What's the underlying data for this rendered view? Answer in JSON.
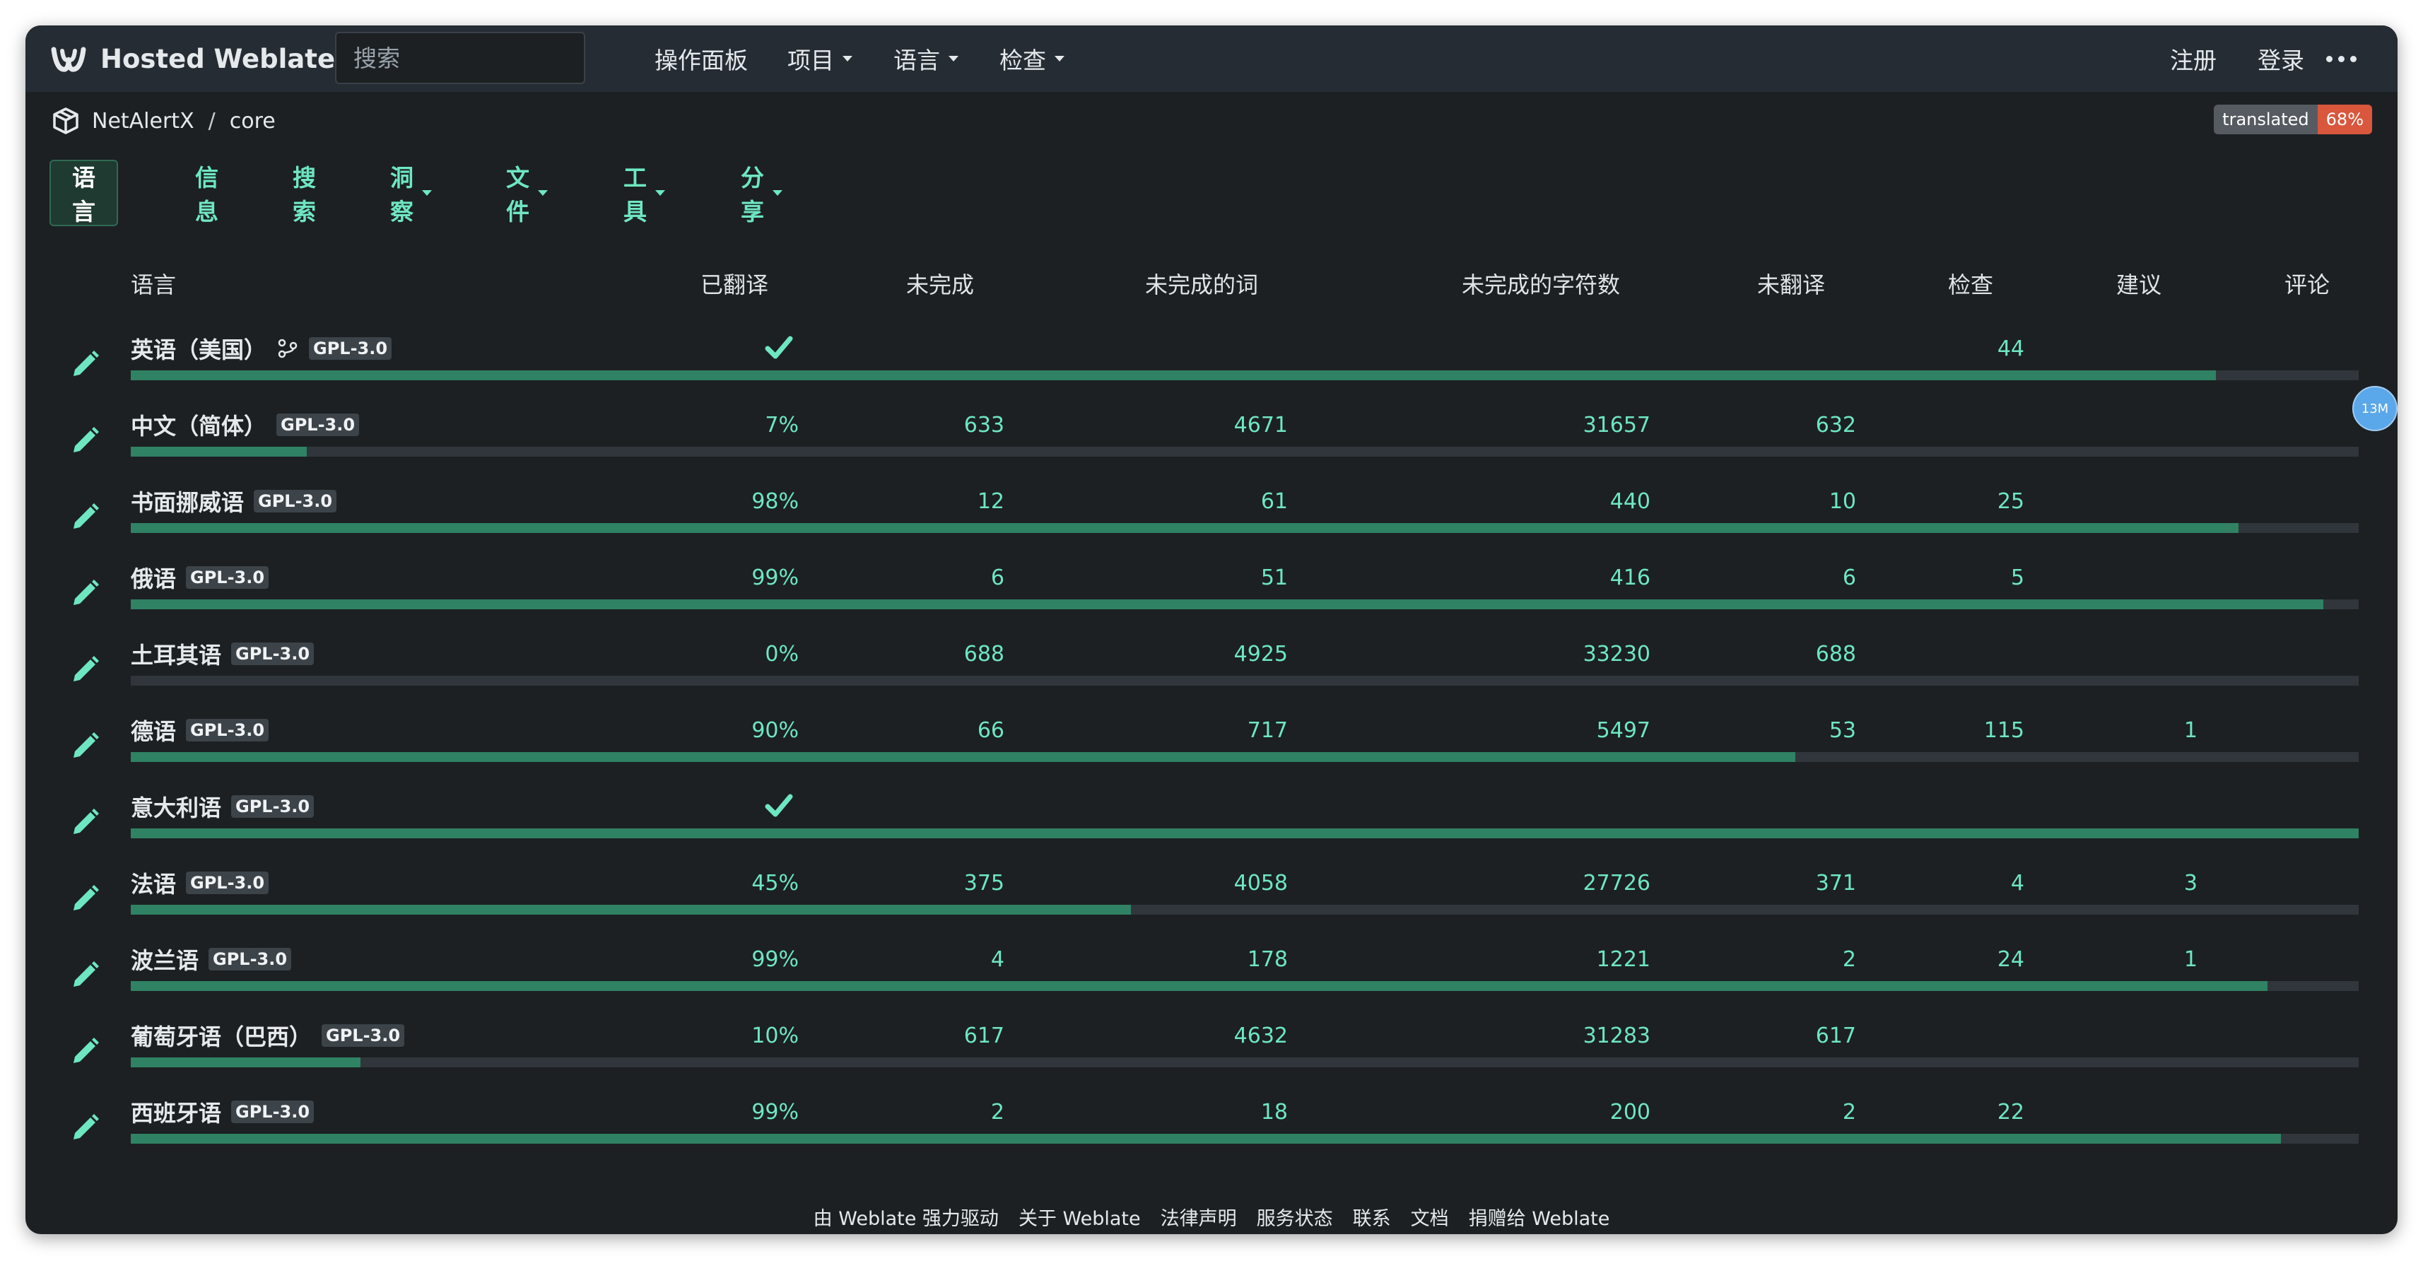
{
  "navbar": {
    "brand": "Hosted Weblate",
    "search_placeholder": "搜索",
    "items": [
      "操作面板",
      "项目",
      "语言",
      "检查"
    ],
    "right": [
      "注册",
      "登录"
    ]
  },
  "breadcrumb": {
    "project": "NetAlertX",
    "component": "core"
  },
  "badge": {
    "label": "translated",
    "value": "68%"
  },
  "tabs": [
    "语言",
    "信息",
    "搜索",
    "洞察",
    "文件",
    "工具",
    "分享"
  ],
  "table": {
    "headers": [
      "语言",
      "已翻译",
      "未完成",
      "未完成的词",
      "未完成的字符数",
      "未翻译",
      "检查",
      "建议",
      "评论"
    ],
    "rows": [
      {
        "lang": "英语（美国）",
        "license": "GPL-3.0",
        "source": true,
        "translated": "",
        "complete": true,
        "pending": "",
        "words": "",
        "chars": "",
        "untranslated": "",
        "checks": "44",
        "suggestions": "",
        "progress": 0.936
      },
      {
        "lang": "中文（简体）",
        "license": "GPL-3.0",
        "translated": "7%",
        "pending": "633",
        "words": "4671",
        "chars": "31657",
        "untranslated": "632",
        "checks": "",
        "suggestions": "",
        "progress": 0.079
      },
      {
        "lang": "书面挪威语",
        "license": "GPL-3.0",
        "translated": "98%",
        "pending": "12",
        "words": "61",
        "chars": "440",
        "untranslated": "10",
        "checks": "25",
        "suggestions": "",
        "progress": 0.946
      },
      {
        "lang": "俄语",
        "license": "GPL-3.0",
        "translated": "99%",
        "pending": "6",
        "words": "51",
        "chars": "416",
        "untranslated": "6",
        "checks": "5",
        "suggestions": "",
        "progress": 0.984
      },
      {
        "lang": "土耳其语",
        "license": "GPL-3.0",
        "translated": "0%",
        "pending": "688",
        "words": "4925",
        "chars": "33230",
        "untranslated": "688",
        "checks": "",
        "suggestions": "",
        "progress": 0.0
      },
      {
        "lang": "德语",
        "license": "GPL-3.0",
        "translated": "90%",
        "pending": "66",
        "words": "717",
        "chars": "5497",
        "untranslated": "53",
        "checks": "115",
        "suggestions": "1",
        "progress": 0.747
      },
      {
        "lang": "意大利语",
        "license": "GPL-3.0",
        "translated": "",
        "complete": true,
        "pending": "",
        "words": "",
        "chars": "",
        "untranslated": "",
        "checks": "",
        "suggestions": "",
        "progress": 1.0
      },
      {
        "lang": "法语",
        "license": "GPL-3.0",
        "translated": "45%",
        "pending": "375",
        "words": "4058",
        "chars": "27726",
        "untranslated": "371",
        "checks": "4",
        "suggestions": "3",
        "progress": 0.449
      },
      {
        "lang": "波兰语",
        "license": "GPL-3.0",
        "translated": "99%",
        "pending": "4",
        "words": "178",
        "chars": "1221",
        "untranslated": "2",
        "checks": "24",
        "suggestions": "1",
        "progress": 0.959
      },
      {
        "lang": "葡萄牙语（巴西）",
        "license": "GPL-3.0",
        "translated": "10%",
        "pending": "617",
        "words": "4632",
        "chars": "31283",
        "untranslated": "617",
        "checks": "",
        "suggestions": "",
        "progress": 0.103
      },
      {
        "lang": "西班牙语",
        "license": "GPL-3.0",
        "translated": "99%",
        "pending": "2",
        "words": "18",
        "chars": "200",
        "untranslated": "2",
        "checks": "22",
        "suggestions": "",
        "progress": 0.965
      }
    ]
  },
  "floating_badge": "13M",
  "footer": [
    "由 Weblate 强力驱动",
    "关于 Weblate",
    "法律声明",
    "服务状态",
    "联系",
    "文档",
    "捐赠给 Weblate"
  ],
  "colors": {
    "accent": "#6ee7c0",
    "bar_fill": "#2f8263",
    "badge_value": "#d9573c"
  }
}
